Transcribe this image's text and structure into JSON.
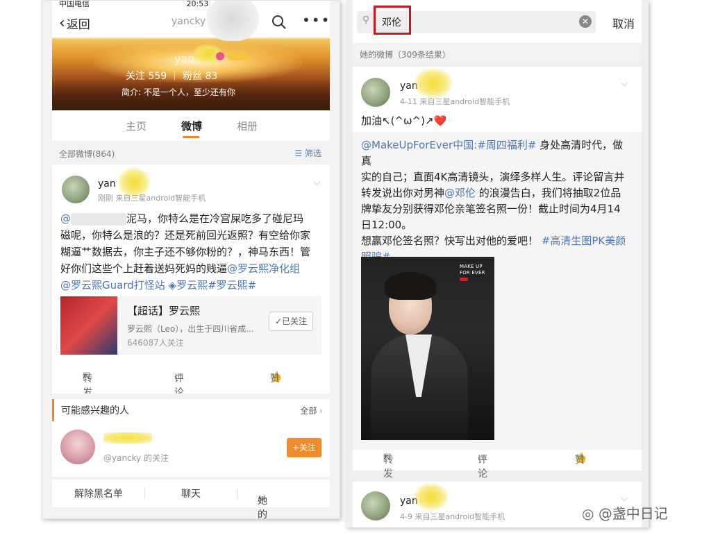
{
  "left": {
    "status": {
      "carrier": "中国电信",
      "time": "20:53"
    },
    "nav": {
      "back": "返回",
      "title": "yancky"
    },
    "profile": {
      "name": "yan",
      "stats": "关注 559 ｜ 粉丝 83",
      "bio": "简介: 不是一个人，至少还有你"
    },
    "tabs": [
      "主页",
      "微博",
      "相册"
    ],
    "section": {
      "label": "全部微博(864)",
      "filter": "筛选"
    },
    "post": {
      "name": "yan",
      "time_source": "刚刚  来自三星android智能手机",
      "line1_prefix": "@",
      "line1_suffix": "泥马，你特么是在冷宫屎吃多了碰尼玛",
      "line2": "磁呢，你特么是浪的？还是死前回光返照？有空给你家",
      "line3": "糊逼艹数据去，你主子还不够你粉的？，神马东西！管",
      "line4_text": "好你们这些个上赶着送妈死妈的贱逼",
      "line4_link": "@罗云熙净化组",
      "line5_link1": "@罗云熙Guard打怪站",
      "line5_link2": "罗云熙#罗云熙#",
      "card": {
        "title": "【超话】罗云熙",
        "desc": "罗云熙（Leo），出生于四川省成...",
        "followers": "646087人关注",
        "follow_btn": "✓已关注"
      },
      "actions": {
        "repost": "转发",
        "comment": "评论",
        "like": "赞"
      }
    },
    "suggest": {
      "title": "可能感兴趣的人",
      "all": "全部",
      "sub": "@yancky 的关注",
      "add": "+关注"
    },
    "bottom": {
      "unblock": "解除黑名单",
      "chat": "聊天",
      "hot": "她的热门"
    }
  },
  "right": {
    "search": {
      "query": "邓伦",
      "cancel": "取消"
    },
    "results": "她的微博（309条结果）",
    "post": {
      "name": "yan",
      "time_source": "4-11  来自三星android智能手机",
      "text": "加油↖(^ω^)↗❤️",
      "quote_l1_link": "@MakeUpForEver中国:#周四福利#",
      "quote_l1_text": " 身处高清时代，做真",
      "quote_l2": "实的自己；直面4K高清镜头，演绎多样人生。评论留言并",
      "quote_l3_a": "转发说出你对男神",
      "quote_l3_link": "@邓伦",
      "quote_l3_b": " 的浪漫告白，我们将抽取2位品",
      "quote_l4": "牌挚友分别获得邓伦亲笔签名照一份！截止时间为4月14",
      "quote_l5": "日12:00。",
      "quote_l6_text": "想赢邓伦签名照？快写出对他的爱吧！",
      "quote_l6_link": "#高清生图PK美颜",
      "quote_l7_link": "照骗#",
      "photo_logo": "MAKE UP FOR EVER",
      "actions": {
        "repost": "转发",
        "comment": "评论",
        "like": "赞"
      }
    },
    "post2": {
      "name": "yan",
      "time_source": "4-9  来自三星android智能手机"
    }
  },
  "watermark": "@盏中日记"
}
